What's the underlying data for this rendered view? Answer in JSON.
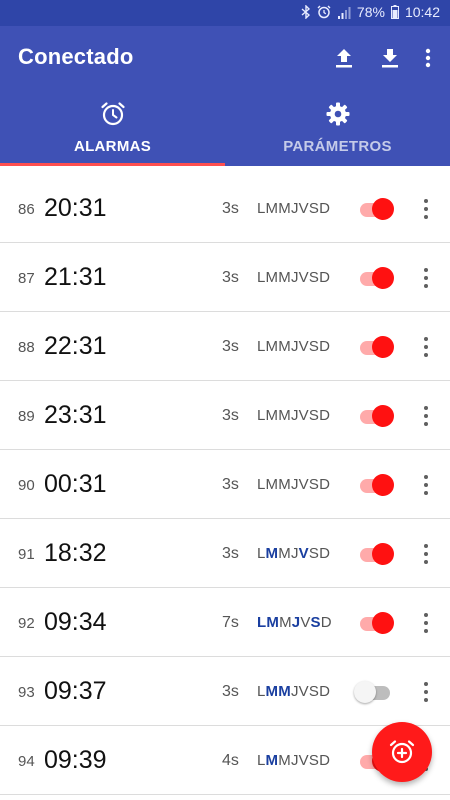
{
  "status_bar": {
    "icons": [
      "bluetooth-icon",
      "alarm-icon",
      "signal-icon",
      "battery-icon"
    ],
    "battery": "78%",
    "time": "10:42"
  },
  "app_bar": {
    "title": "Conectado",
    "actions": [
      "upload-icon",
      "download-icon",
      "more-vert-icon"
    ]
  },
  "tabs": [
    {
      "label": "ALARMAS",
      "icon": "alarm-clock-icon",
      "active": true
    },
    {
      "label": "PARÁMETROS",
      "icon": "gear-icon",
      "active": false
    }
  ],
  "colors": {
    "primary": "#3f51b5",
    "status_bar": "#2f45a8",
    "accent": "#ff1111",
    "tab_indicator": "#ff4f4f",
    "day_active": "#1a3fa0"
  },
  "alarms": [
    {
      "num": "86",
      "time": "20:31",
      "duration": "3s",
      "days": [
        {
          "l": "L",
          "on": false
        },
        {
          "l": "M",
          "on": false
        },
        {
          "l": "M",
          "on": false
        },
        {
          "l": "J",
          "on": false
        },
        {
          "l": "V",
          "on": false
        },
        {
          "l": "S",
          "on": false
        },
        {
          "l": "D",
          "on": false
        }
      ],
      "enabled": true
    },
    {
      "num": "87",
      "time": "21:31",
      "duration": "3s",
      "days": [
        {
          "l": "L",
          "on": false
        },
        {
          "l": "M",
          "on": false
        },
        {
          "l": "M",
          "on": false
        },
        {
          "l": "J",
          "on": false
        },
        {
          "l": "V",
          "on": false
        },
        {
          "l": "S",
          "on": false
        },
        {
          "l": "D",
          "on": false
        }
      ],
      "enabled": true
    },
    {
      "num": "88",
      "time": "22:31",
      "duration": "3s",
      "days": [
        {
          "l": "L",
          "on": false
        },
        {
          "l": "M",
          "on": false
        },
        {
          "l": "M",
          "on": false
        },
        {
          "l": "J",
          "on": false
        },
        {
          "l": "V",
          "on": false
        },
        {
          "l": "S",
          "on": false
        },
        {
          "l": "D",
          "on": false
        }
      ],
      "enabled": true
    },
    {
      "num": "89",
      "time": "23:31",
      "duration": "3s",
      "days": [
        {
          "l": "L",
          "on": false
        },
        {
          "l": "M",
          "on": false
        },
        {
          "l": "M",
          "on": false
        },
        {
          "l": "J",
          "on": false
        },
        {
          "l": "V",
          "on": false
        },
        {
          "l": "S",
          "on": false
        },
        {
          "l": "D",
          "on": false
        }
      ],
      "enabled": true
    },
    {
      "num": "90",
      "time": "00:31",
      "duration": "3s",
      "days": [
        {
          "l": "L",
          "on": false
        },
        {
          "l": "M",
          "on": false
        },
        {
          "l": "M",
          "on": false
        },
        {
          "l": "J",
          "on": false
        },
        {
          "l": "V",
          "on": false
        },
        {
          "l": "S",
          "on": false
        },
        {
          "l": "D",
          "on": false
        }
      ],
      "enabled": true
    },
    {
      "num": "91",
      "time": "18:32",
      "duration": "3s",
      "days": [
        {
          "l": "L",
          "on": false
        },
        {
          "l": "M",
          "on": true
        },
        {
          "l": "M",
          "on": false
        },
        {
          "l": "J",
          "on": false
        },
        {
          "l": "V",
          "on": true
        },
        {
          "l": "S",
          "on": false
        },
        {
          "l": "D",
          "on": false
        }
      ],
      "enabled": true
    },
    {
      "num": "92",
      "time": "09:34",
      "duration": "7s",
      "days": [
        {
          "l": "L",
          "on": true
        },
        {
          "l": "M",
          "on": true
        },
        {
          "l": "M",
          "on": false
        },
        {
          "l": "J",
          "on": true
        },
        {
          "l": "V",
          "on": false
        },
        {
          "l": "S",
          "on": true
        },
        {
          "l": "D",
          "on": false
        }
      ],
      "enabled": true
    },
    {
      "num": "93",
      "time": "09:37",
      "duration": "3s",
      "days": [
        {
          "l": "L",
          "on": false
        },
        {
          "l": "M",
          "on": true
        },
        {
          "l": "M",
          "on": true
        },
        {
          "l": "J",
          "on": false
        },
        {
          "l": "V",
          "on": false
        },
        {
          "l": "S",
          "on": false
        },
        {
          "l": "D",
          "on": false
        }
      ],
      "enabled": false
    },
    {
      "num": "94",
      "time": "09:39",
      "duration": "4s",
      "days": [
        {
          "l": "L",
          "on": false
        },
        {
          "l": "M",
          "on": true
        },
        {
          "l": "M",
          "on": false
        },
        {
          "l": "J",
          "on": false
        },
        {
          "l": "V",
          "on": false
        },
        {
          "l": "S",
          "on": false
        },
        {
          "l": "D",
          "on": false
        }
      ],
      "enabled": true
    }
  ],
  "fab": {
    "icon": "add-alarm-icon"
  }
}
